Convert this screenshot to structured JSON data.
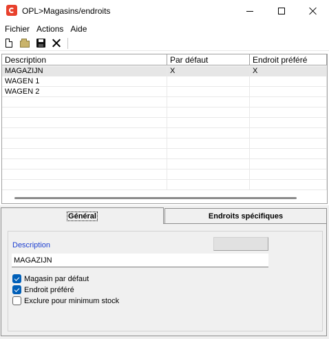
{
  "window": {
    "title": "OPL>Magasins/endroits",
    "icon": "app-logo-icon"
  },
  "menu": {
    "items": [
      "Fichier",
      "Actions",
      "Aide"
    ]
  },
  "toolbar": {
    "buttons": [
      "new-icon",
      "open-icon",
      "save-icon",
      "delete-icon"
    ]
  },
  "grid": {
    "columns": [
      "Description",
      "Par défaut",
      "Endroit préféré"
    ],
    "rows": [
      {
        "description": "MAGAZIJN",
        "par_defaut": "X",
        "endroit_prefere": "X",
        "selected": true
      },
      {
        "description": "WAGEN 1",
        "par_defaut": "",
        "endroit_prefere": "",
        "selected": false
      },
      {
        "description": "WAGEN 2",
        "par_defaut": "",
        "endroit_prefere": "",
        "selected": false
      }
    ]
  },
  "tabs": {
    "general": "Général",
    "endroits": "Endroits spécifiques"
  },
  "form": {
    "description_label": "Description",
    "description_value": "MAGAZIJN",
    "checkboxes": [
      {
        "label": "Magasin par défaut",
        "checked": true
      },
      {
        "label": "Endroit préféré",
        "checked": true
      },
      {
        "label": "Exclure pour minimum stock",
        "checked": false
      }
    ]
  },
  "colors": {
    "accent": "#005fb8",
    "label_blue": "#1d3fd0",
    "app_icon": "#e8412d"
  }
}
